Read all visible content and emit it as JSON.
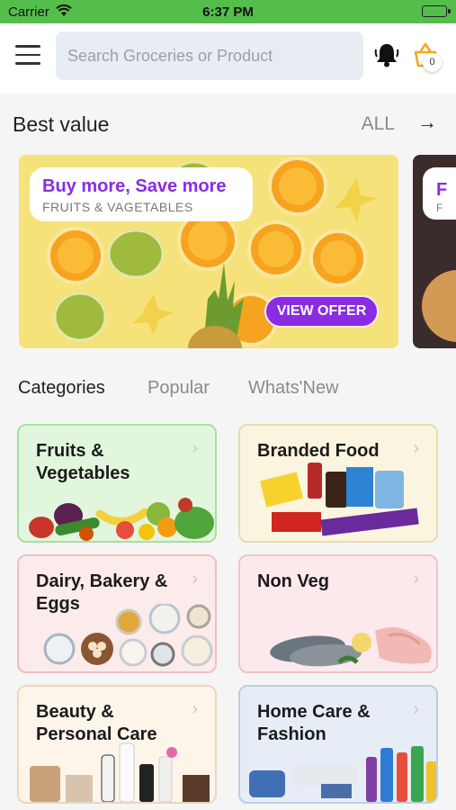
{
  "status_bar": {
    "carrier": "Carrier",
    "time": "6:37 PM"
  },
  "header": {
    "search_placeholder": "Search Groceries or Product",
    "cart_count": "0",
    "icons": [
      "menu-icon",
      "bell-icon",
      "basket-icon"
    ]
  },
  "best_value": {
    "title": "Best value",
    "all_label": "ALL",
    "arrow": "→",
    "banners": [
      {
        "headline": "Buy more, Save more",
        "subtitle": "FRUITS & VAGETABLES",
        "button": "VIEW OFFER"
      },
      {
        "headline": "F",
        "subtitle": "F"
      }
    ]
  },
  "tabs": [
    "Categories",
    "Popular",
    "Whats'New"
  ],
  "categories": [
    {
      "label": "Fruits & Vegetables"
    },
    {
      "label": "Branded Food"
    },
    {
      "label": "Dairy, Bakery & Eggs"
    },
    {
      "label": "Non Veg"
    },
    {
      "label": "Beauty & Personal Care"
    },
    {
      "label": "Home Care & Fashion"
    }
  ],
  "colors": {
    "status_bar": "#55bd4a",
    "accent_purple": "#8b2be2",
    "background": "#f5f5f5"
  }
}
